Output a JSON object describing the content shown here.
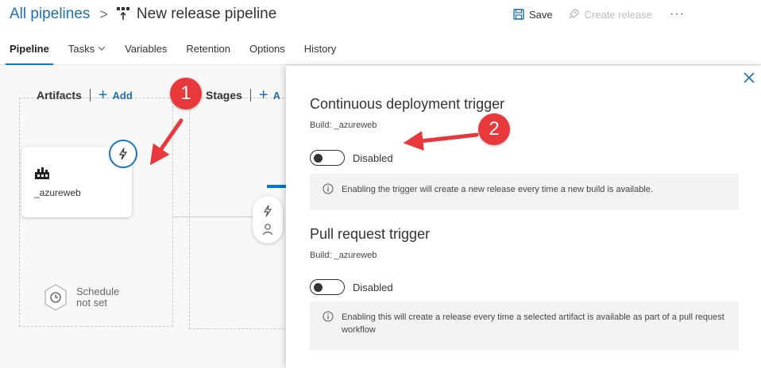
{
  "header": {
    "breadcrumb_root": "All pipelines",
    "breadcrumb_sep": ">",
    "title": "New release pipeline",
    "save_label": "Save",
    "create_release_label": "Create release",
    "more_label": "···"
  },
  "tabs": [
    {
      "label": "Pipeline",
      "active": true
    },
    {
      "label": "Tasks",
      "active": false
    },
    {
      "label": "Variables",
      "active": false
    },
    {
      "label": "Retention",
      "active": false
    },
    {
      "label": "Options",
      "active": false
    },
    {
      "label": "History",
      "active": false
    }
  ],
  "canvas": {
    "artifacts_title": "Artifacts",
    "add_label": "Add",
    "stages_title": "Stages",
    "stages_add_partial": "A",
    "artifact_name": "_azureweb",
    "schedule_line1": "Schedule",
    "schedule_line2": "not set"
  },
  "callouts": {
    "one": "1",
    "two": "2"
  },
  "panel": {
    "cd": {
      "title": "Continuous deployment trigger",
      "build_source": "Build: _azureweb",
      "toggle_state": "Disabled",
      "info": "Enabling the trigger will create a new release every time a new build is available."
    },
    "pr": {
      "title": "Pull request trigger",
      "build_source": "Build: _azureweb",
      "toggle_state": "Disabled",
      "info": "Enabling this will create a release every time a selected artifact is available as part of a pull request workflow"
    }
  },
  "colors": {
    "accent": "#0078d4",
    "link": "#1f6fb2",
    "callout": "#e8383b"
  },
  "icons": {
    "pipeline": "pipeline-icon",
    "save": "save-icon",
    "rocket": "rocket-icon",
    "trigger": "lightning-icon",
    "build": "build-artifact-icon",
    "schedule": "clock-icon",
    "user": "person-icon",
    "info": "info-icon",
    "close": "close-icon"
  }
}
